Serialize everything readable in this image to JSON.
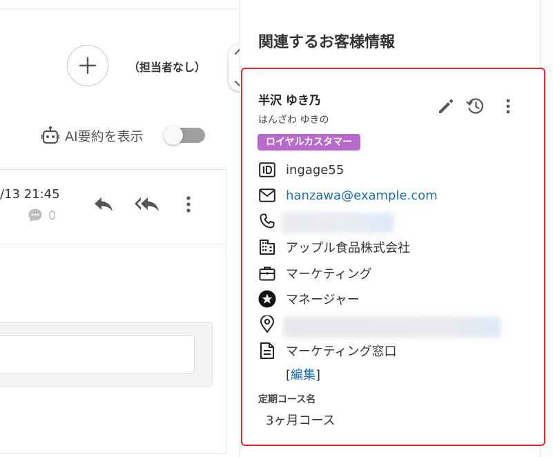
{
  "conversation": {
    "assignee_label": "（担当者なし）",
    "ai_summary_label": "AI要約を表示",
    "ai_summary_enabled": false,
    "message": {
      "timestamp": "/13 21:45",
      "comment_count": "0"
    }
  },
  "customer_panel": {
    "title": "関連するお客様情報",
    "name": "半沢 ゆき乃",
    "name_kana": "はんざわ ゆきの",
    "badge": "ロイヤルカスタマー",
    "customer_id": "ingage55",
    "email": "hanzawa@example.com",
    "company": "アップル食品株式会社",
    "department": "マーケティング",
    "position": "マネージャー",
    "note": "マーケティング窓口",
    "edit_open": "[",
    "edit_label": "編集",
    "edit_close": "]",
    "subscription_label": "定期コース名",
    "subscription_value": "3ヶ月コース"
  },
  "colors": {
    "highlight_border": "#e3262b",
    "badge_bg": "#b76ac9",
    "link": "#1a6fb5",
    "icon": "#555555"
  }
}
